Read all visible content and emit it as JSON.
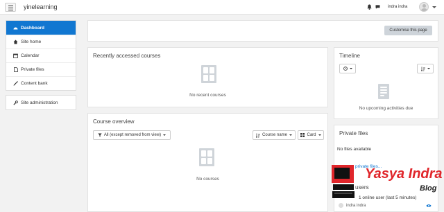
{
  "navbar": {
    "brand": "yinelearning",
    "user_name": "indra indra"
  },
  "sidebar": {
    "group1": [
      {
        "label": "Dashboard",
        "icon": "dashboard-icon",
        "active": true
      },
      {
        "label": "Site home",
        "icon": "home-icon"
      },
      {
        "label": "Calendar",
        "icon": "calendar-icon"
      },
      {
        "label": "Private files",
        "icon": "file-icon"
      },
      {
        "label": "Content bank",
        "icon": "paint-brush-icon"
      }
    ],
    "group2": [
      {
        "label": "Site administration",
        "icon": "wrench-icon"
      }
    ]
  },
  "header": {
    "customise_label": "Customise this page"
  },
  "recent": {
    "title": "Recently accessed courses",
    "empty": "No recent courses"
  },
  "overview": {
    "title": "Course overview",
    "filter": "All (except removed from view)",
    "sort": "Course name",
    "view": "Card",
    "empty": "No courses"
  },
  "timeline": {
    "title": "Timeline",
    "empty": "No upcoming activities due"
  },
  "private_files": {
    "title": "Private files",
    "empty": "No files available",
    "link": "private files..."
  },
  "online_users": {
    "title": "users",
    "count_text": "1 online user (last 5 minutes)",
    "user": "indra indra"
  },
  "watermark": {
    "line1": "Yasya Indra",
    "line2": "Blog",
    "color": "#e0262b"
  }
}
